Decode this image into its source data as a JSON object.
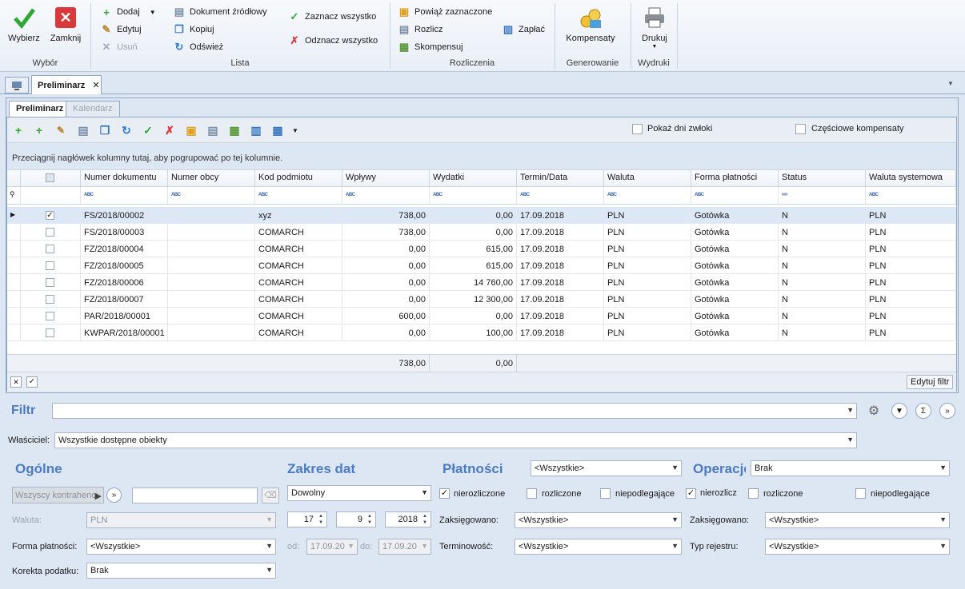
{
  "ribbon": {
    "wybor": {
      "label": "Wybór",
      "select": "Wybierz",
      "close": "Zamknij"
    },
    "lista": {
      "label": "Lista",
      "add": "Dodaj",
      "edit": "Edytuj",
      "delete": "Usuń",
      "source_doc": "Dokument źródłowy",
      "copy": "Kopiuj",
      "refresh": "Odśwież",
      "select_all": "Zaznacz wszystko",
      "deselect_all": "Odznacz wszystko"
    },
    "rozliczenia": {
      "label": "Rozliczenia",
      "link_selected": "Powiąż zaznaczone",
      "settle": "Rozlicz",
      "compensate": "Skompensuj",
      "pay": "Zapłać"
    },
    "generowanie": {
      "label": "Generowanie",
      "kompensaty": "Kompensaty"
    },
    "wydruki": {
      "label": "Wydruki",
      "print": "Drukuj"
    }
  },
  "doc_tab": {
    "title": "Preliminarz",
    "close": "✕"
  },
  "sub_tabs": {
    "active": "Preliminarz",
    "inactive": "Kalendarz"
  },
  "options": {
    "show_delay": "Pokaż dni zwłoki",
    "partial_comp": "Częściowe kompensaty"
  },
  "group_hint": "Przeciągnij nagłówek kolumny tutaj, aby pogrupować po tej kolumnie.",
  "columns": [
    "Numer dokumentu",
    "Numer obcy",
    "Kod podmiotu",
    "Wpływy",
    "Wydatki",
    "Termin/Data",
    "Waluta",
    "Forma płatności",
    "Status",
    "Waluta systemowa"
  ],
  "rows": [
    {
      "num": "FS/2018/00002",
      "ext": "",
      "code": "xyz",
      "in": "738,00",
      "out": "0,00",
      "date": "17.09.2018",
      "cur": "PLN",
      "pay": "Gotówka",
      "status": "N",
      "syscur": "PLN",
      "checked": "✓"
    },
    {
      "num": "FS/2018/00003",
      "ext": "",
      "code": "COMARCH",
      "in": "738,00",
      "out": "0,00",
      "date": "17.09.2018",
      "cur": "PLN",
      "pay": "Gotówka",
      "status": "N",
      "syscur": "PLN",
      "checked": ""
    },
    {
      "num": "FZ/2018/00004",
      "ext": "",
      "code": "COMARCH",
      "in": "0,00",
      "out": "615,00",
      "date": "17.09.2018",
      "cur": "PLN",
      "pay": "Gotówka",
      "status": "N",
      "syscur": "PLN",
      "checked": ""
    },
    {
      "num": "FZ/2018/00005",
      "ext": "",
      "code": "COMARCH",
      "in": "0,00",
      "out": "615,00",
      "date": "17.09.2018",
      "cur": "PLN",
      "pay": "Gotówka",
      "status": "N",
      "syscur": "PLN",
      "checked": ""
    },
    {
      "num": "FZ/2018/00006",
      "ext": "",
      "code": "COMARCH",
      "in": "0,00",
      "out": "14 760,00",
      "date": "17.09.2018",
      "cur": "PLN",
      "pay": "Gotówka",
      "status": "N",
      "syscur": "PLN",
      "checked": ""
    },
    {
      "num": "FZ/2018/00007",
      "ext": "",
      "code": "COMARCH",
      "in": "0,00",
      "out": "12 300,00",
      "date": "17.09.2018",
      "cur": "PLN",
      "pay": "Gotówka",
      "status": "N",
      "syscur": "PLN",
      "checked": ""
    },
    {
      "num": "PAR/2018/00001",
      "ext": "",
      "code": "COMARCH",
      "in": "600,00",
      "out": "0,00",
      "date": "17.09.2018",
      "cur": "PLN",
      "pay": "Gotówka",
      "status": "N",
      "syscur": "PLN",
      "checked": ""
    },
    {
      "num": "KWPAR/2018/00001",
      "ext": "",
      "code": "COMARCH",
      "in": "0,00",
      "out": "100,00",
      "date": "17.09.2018",
      "cur": "PLN",
      "pay": "Gotówka",
      "status": "N",
      "syscur": "PLN",
      "checked": ""
    }
  ],
  "totals": {
    "in": "738,00",
    "out": "0,00"
  },
  "edit_filter": "Edytuj filtr",
  "filter": {
    "label": "Filtr",
    "value": "",
    "owner_label": "Właściciel:",
    "owner_value": "Wszystkie dostępne obiekty",
    "general": {
      "title": "Ogólne",
      "contractor_btn": "Wszyscy kontrahenci",
      "contractor_value": "",
      "currency_label": "Waluta:",
      "currency_value": "PLN",
      "payment_form_label": "Forma płatności:",
      "payment_form_value": "<Wszystkie>",
      "tax_corr_label": "Korekta podatku:",
      "tax_corr_value": "Brak"
    },
    "dates": {
      "title": "Zakres dat",
      "mode": "Dowolny",
      "day": "17",
      "month": "9",
      "year": "2018",
      "from_label": "od:",
      "from_value": "17.09.20",
      "to_label": "do:",
      "to_value": "17.09.20"
    },
    "payments": {
      "title": "Płatności",
      "filter_value": "<Wszystkie>",
      "unsettled": "nierozliczone",
      "settled": "rozliczone",
      "not_subject": "niepodlegające",
      "booked_label": "Zaksięgowano:",
      "booked_value": "<Wszystkie>",
      "term_label": "Terminowość:",
      "term_value": "<Wszystkie>"
    },
    "operations": {
      "title": "Operacje",
      "value": "Brak",
      "unsettled": "nierozlicz",
      "settled": "rozliczone",
      "not_subject": "niepodlegające",
      "booked_label": "Zaksięgowano:",
      "booked_value": "<Wszystkie>",
      "reg_label": "Typ rejestru:",
      "reg_value": "<Wszystkie>"
    }
  },
  "colors": {
    "accent": "#4d7bbf",
    "selected_row": "#dde8f6",
    "green": "#2fa832",
    "red": "#d9393a"
  }
}
